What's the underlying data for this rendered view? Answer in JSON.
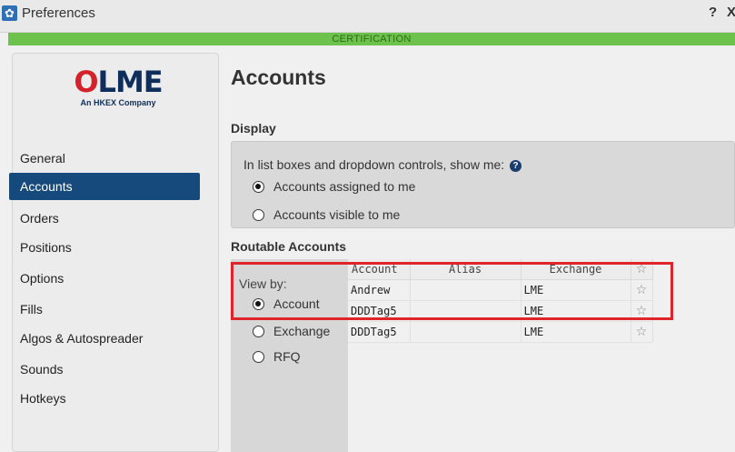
{
  "window": {
    "title": "Preferences",
    "help_label": "?",
    "close_label": "X",
    "environment_banner": "CERTIFICATION"
  },
  "logo": {
    "mark_prefix": "O",
    "mark_text": "LME",
    "subtitle": "An HKEX Company"
  },
  "sidebar": {
    "items": [
      {
        "label": "General"
      },
      {
        "label": "Accounts",
        "active": true
      },
      {
        "label": "Orders"
      },
      {
        "label": "Positions"
      },
      {
        "label": "Options"
      },
      {
        "label": "Fills"
      },
      {
        "label": "Algos & Autospreader"
      },
      {
        "label": "Sounds"
      },
      {
        "label": "Hotkeys"
      }
    ]
  },
  "page": {
    "title": "Accounts"
  },
  "display": {
    "section_label": "Display",
    "prompt": "In list boxes and dropdown controls, show me:",
    "help_icon": "?",
    "options": [
      {
        "label": "Accounts assigned to me",
        "checked": true
      },
      {
        "label": "Accounts visible to me",
        "checked": false
      }
    ]
  },
  "routable": {
    "section_label": "Routable Accounts",
    "view_by_label": "View by:",
    "view_by_options": [
      {
        "label": "Account",
        "checked": true
      },
      {
        "label": "Exchange",
        "checked": false
      },
      {
        "label": "RFQ",
        "checked": false
      }
    ],
    "columns": {
      "account": "Account",
      "alias": "Alias",
      "exchange": "Exchange",
      "favorite": "☆"
    },
    "rows": [
      {
        "account": "Andrew",
        "alias": "",
        "exchange": "LME",
        "favorite": "☆"
      },
      {
        "account": "DDDTag5",
        "alias": "",
        "exchange": "LME",
        "favorite": "☆"
      },
      {
        "account": "DDDTag5",
        "alias": "",
        "exchange": "LME",
        "favorite": "☆"
      }
    ]
  },
  "colors": {
    "banner_green": "#6cc24a",
    "nav_active": "#174a7c",
    "highlight_red": "#e0242b",
    "logo_navy": "#0f2e5c",
    "logo_red": "#d2232a"
  }
}
